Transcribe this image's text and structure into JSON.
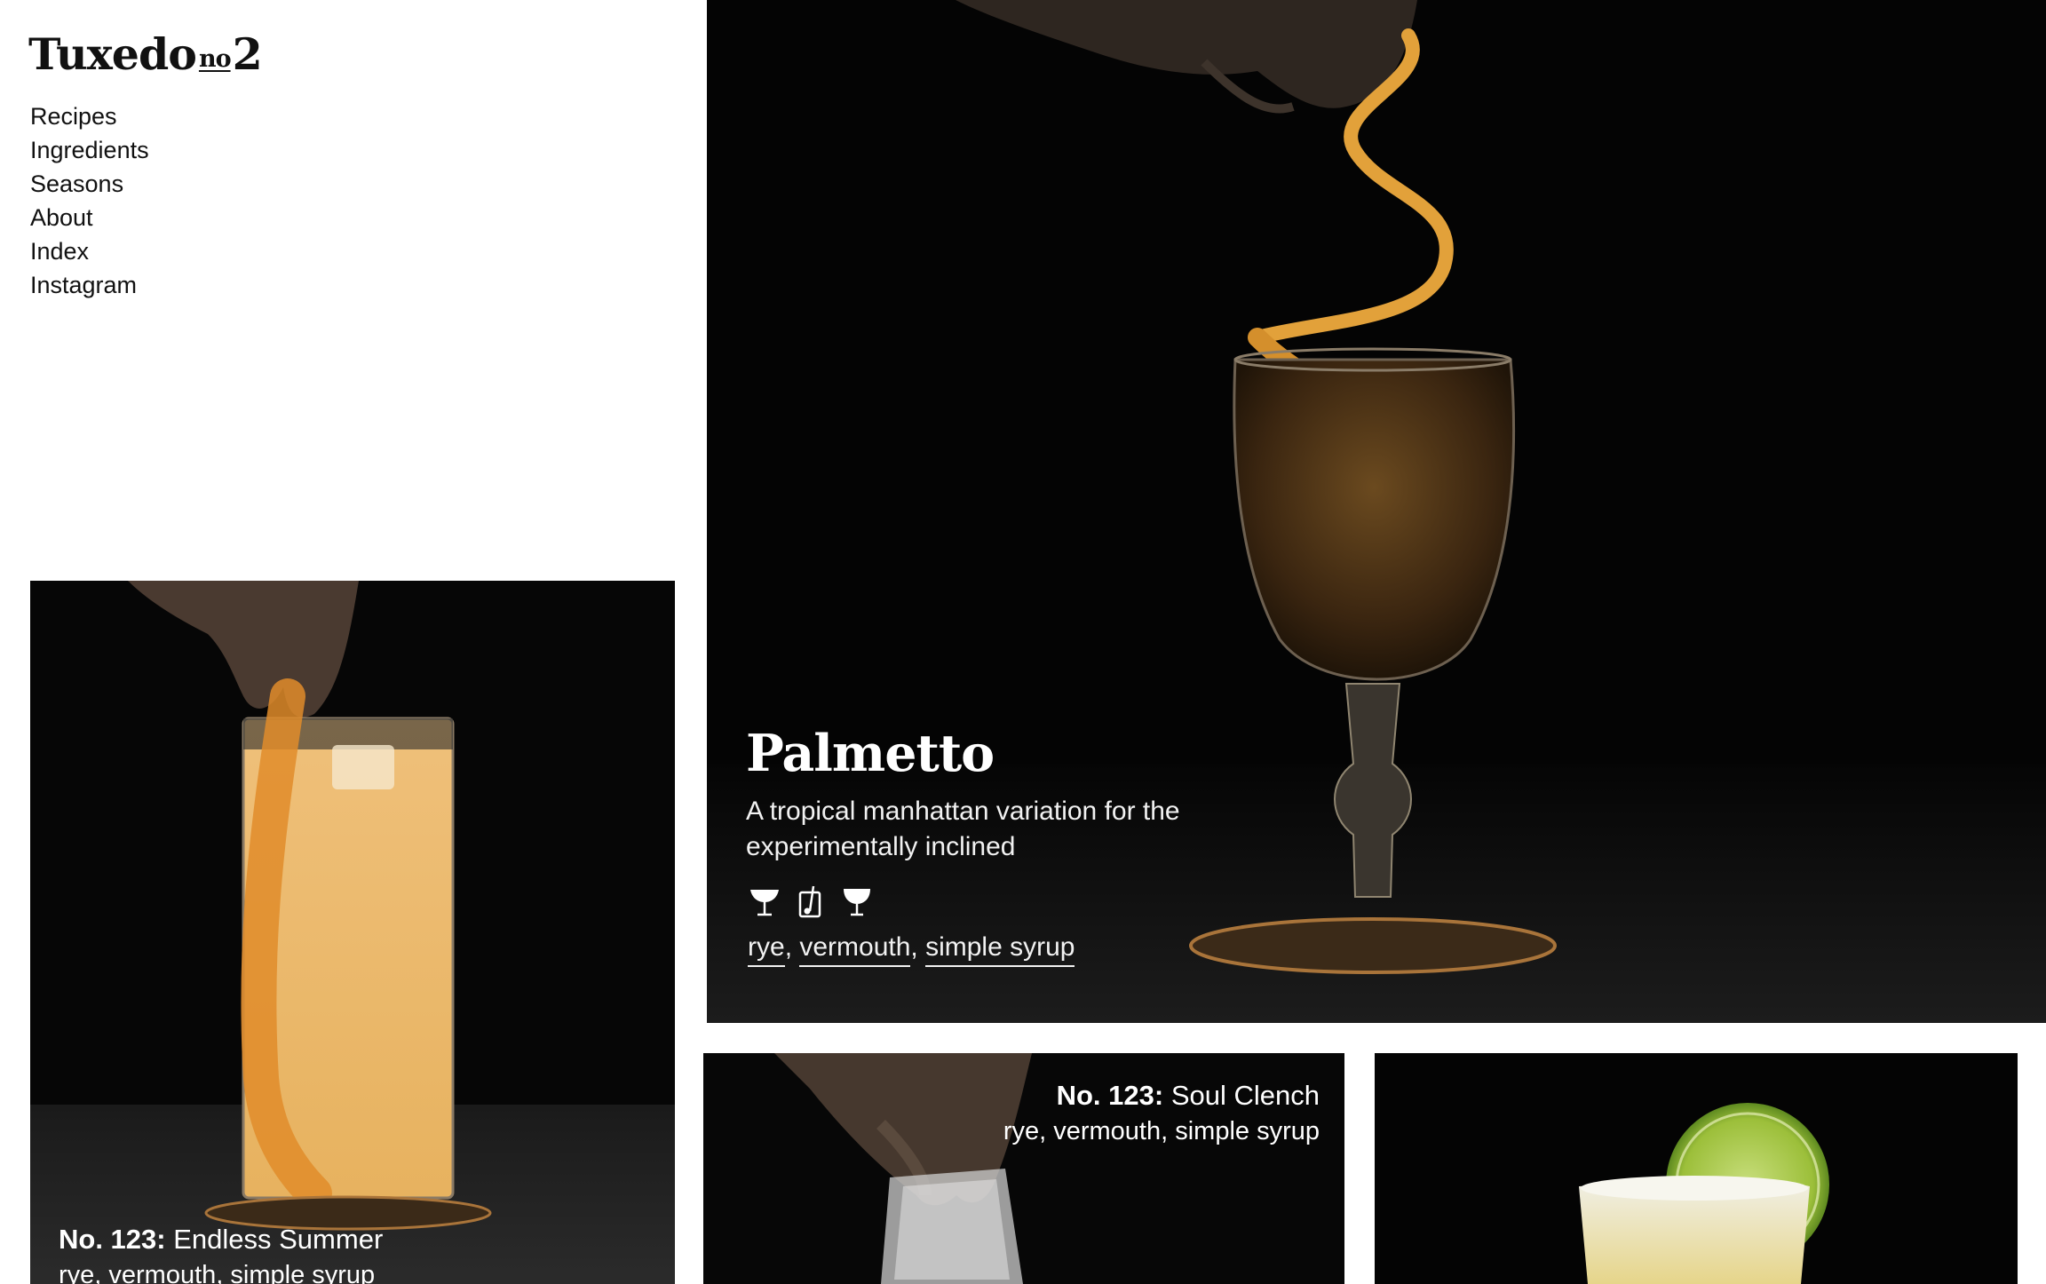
{
  "brand": {
    "name": "Tuxedo",
    "no": "no",
    "number": "2"
  },
  "nav": [
    "Recipes",
    "Ingredients",
    "Seasons",
    "About",
    "Index",
    "Instagram"
  ],
  "search": {
    "placeholder": ""
  },
  "hero": {
    "title": "Palmetto",
    "description": "A tropical manhattan variation for the experimentally inclined",
    "glass_icons": [
      "coupe-glass-icon",
      "mixing-glass-icon",
      "nick-and-nora-glass-icon"
    ],
    "tags": [
      "rye",
      "vermouth",
      "simple syrup"
    ]
  },
  "cards": [
    {
      "number": "No. 123:",
      "name": "Endless Summer",
      "ingredients": "rye, vermouth, simple syrup"
    },
    {
      "number": "No. 123:",
      "name": "Soul Clench",
      "ingredients": "rye, vermouth, simple syrup"
    },
    {
      "number": "",
      "name": "",
      "ingredients": ""
    }
  ],
  "colors": {
    "background": "#ffffff",
    "photo_bg": "#050505",
    "text_dark": "#111111",
    "text_light": "#ffffff",
    "search_bg": "#2b2b2b",
    "citrus": "#e2a13a"
  }
}
